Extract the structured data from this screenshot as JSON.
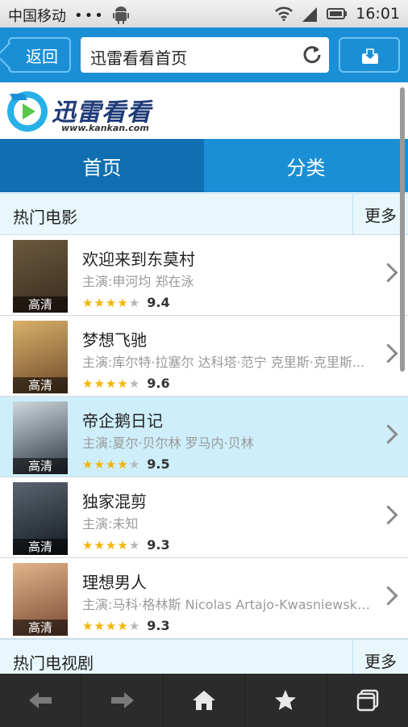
{
  "status_bar": {
    "carrier": "中国移动",
    "dots": "•••",
    "time": "16:01"
  },
  "toolbar": {
    "back_label": "返回",
    "address_title": "迅雷看看首页"
  },
  "logo": {
    "word": "迅雷看看",
    "url": "www.kankan.com"
  },
  "nav_tabs": [
    {
      "label": "首页",
      "active": true
    },
    {
      "label": "分类",
      "active": false
    }
  ],
  "sections": {
    "movies": {
      "title": "热门电影",
      "more": "更多"
    },
    "tv": {
      "title": "热门电视剧",
      "more": "更多"
    }
  },
  "movies": [
    {
      "title": "欢迎来到东莫村",
      "cast": "主演:申河均 郑在泳",
      "badge": "高清",
      "stars_on": 4,
      "rating": "9.4",
      "poster_colors": [
        "#6b5a3e",
        "#3b2a1e"
      ],
      "selected": false
    },
    {
      "title": "梦想飞驰",
      "cast": "主演:库尔特·拉塞尔 达科塔·范宁 克里斯·克里斯...",
      "badge": "高清",
      "stars_on": 4,
      "rating": "9.6",
      "poster_colors": [
        "#d9b06a",
        "#6e4a2a"
      ],
      "selected": false
    },
    {
      "title": "帝企鹅日记",
      "cast": "主演:夏尔·贝尔林 罗马内·贝林",
      "badge": "高清",
      "stars_on": 4,
      "rating": "9.5",
      "poster_colors": [
        "#cfd8de",
        "#2c3640"
      ],
      "selected": true
    },
    {
      "title": "独家混剪",
      "cast": "主演:未知",
      "badge": "高清",
      "stars_on": 4,
      "rating": "9.3",
      "poster_colors": [
        "#5a6570",
        "#141a20"
      ],
      "selected": false
    },
    {
      "title": "理想男人",
      "cast": "主演:马科·格林斯 Nicolas Artajo-Kwasniewski A...",
      "badge": "高清",
      "stars_on": 4,
      "rating": "9.3",
      "poster_colors": [
        "#e2b48a",
        "#7a4a32"
      ],
      "selected": false
    }
  ],
  "bottom_bar": [
    "back-arrow-icon",
    "forward-arrow-icon",
    "home-icon",
    "star-icon",
    "windows-icon"
  ],
  "colors": {
    "primary_blue": "#1a8fd6",
    "tab_active": "#0f6fb1",
    "star": "#f5b400"
  }
}
